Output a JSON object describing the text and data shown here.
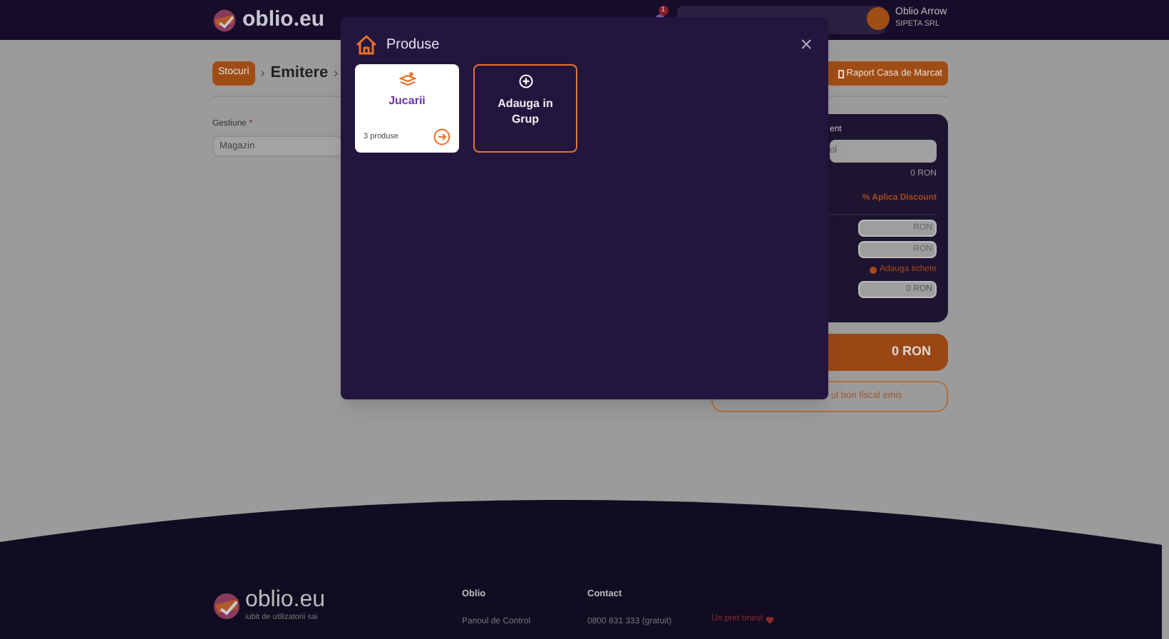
{
  "header": {
    "logo": "oblio.eu",
    "notification_count": "1",
    "user": {
      "name": "Oblio Arrow",
      "company": "SIPETA SRL"
    }
  },
  "breadcrumb": {
    "badge": "Stocuri",
    "separator": "›",
    "current": "Emitere",
    "separator_2": "›"
  },
  "report_button": "Raport Casa de Marcat",
  "form": {
    "label": "Gestiune",
    "required_mark": "*",
    "value": "Magazin"
  },
  "summary_panel": {
    "label": "ent",
    "field_placeholder": "ol",
    "total": "0 RON",
    "discount_link": "% Aplica Discount",
    "payment_fields": [
      {
        "value": "RON"
      },
      {
        "value": "RON"
      }
    ],
    "tickets_link": "Adauga tichete",
    "change_field": "0 RON"
  },
  "pay_button": "0 RON",
  "last_receipt_button": "ul bon fiscal emis",
  "modal": {
    "title": "Produse",
    "close": "×",
    "items": [
      {
        "kind": "group",
        "name": "Jucarii",
        "count": "3 produse"
      },
      {
        "kind": "add",
        "label": "Adauga in Grup"
      }
    ]
  },
  "footer": {
    "logo": "oblio.eu",
    "tagline": "iubit de utilizatorii sai",
    "columns": [
      {
        "title": "Oblio",
        "links": [
          "Panoul de Control"
        ]
      },
      {
        "title": "Contact",
        "links": [
          "0800 831 333 (gratuit)"
        ]
      }
    ],
    "honest_price": "Un pret onest"
  }
}
